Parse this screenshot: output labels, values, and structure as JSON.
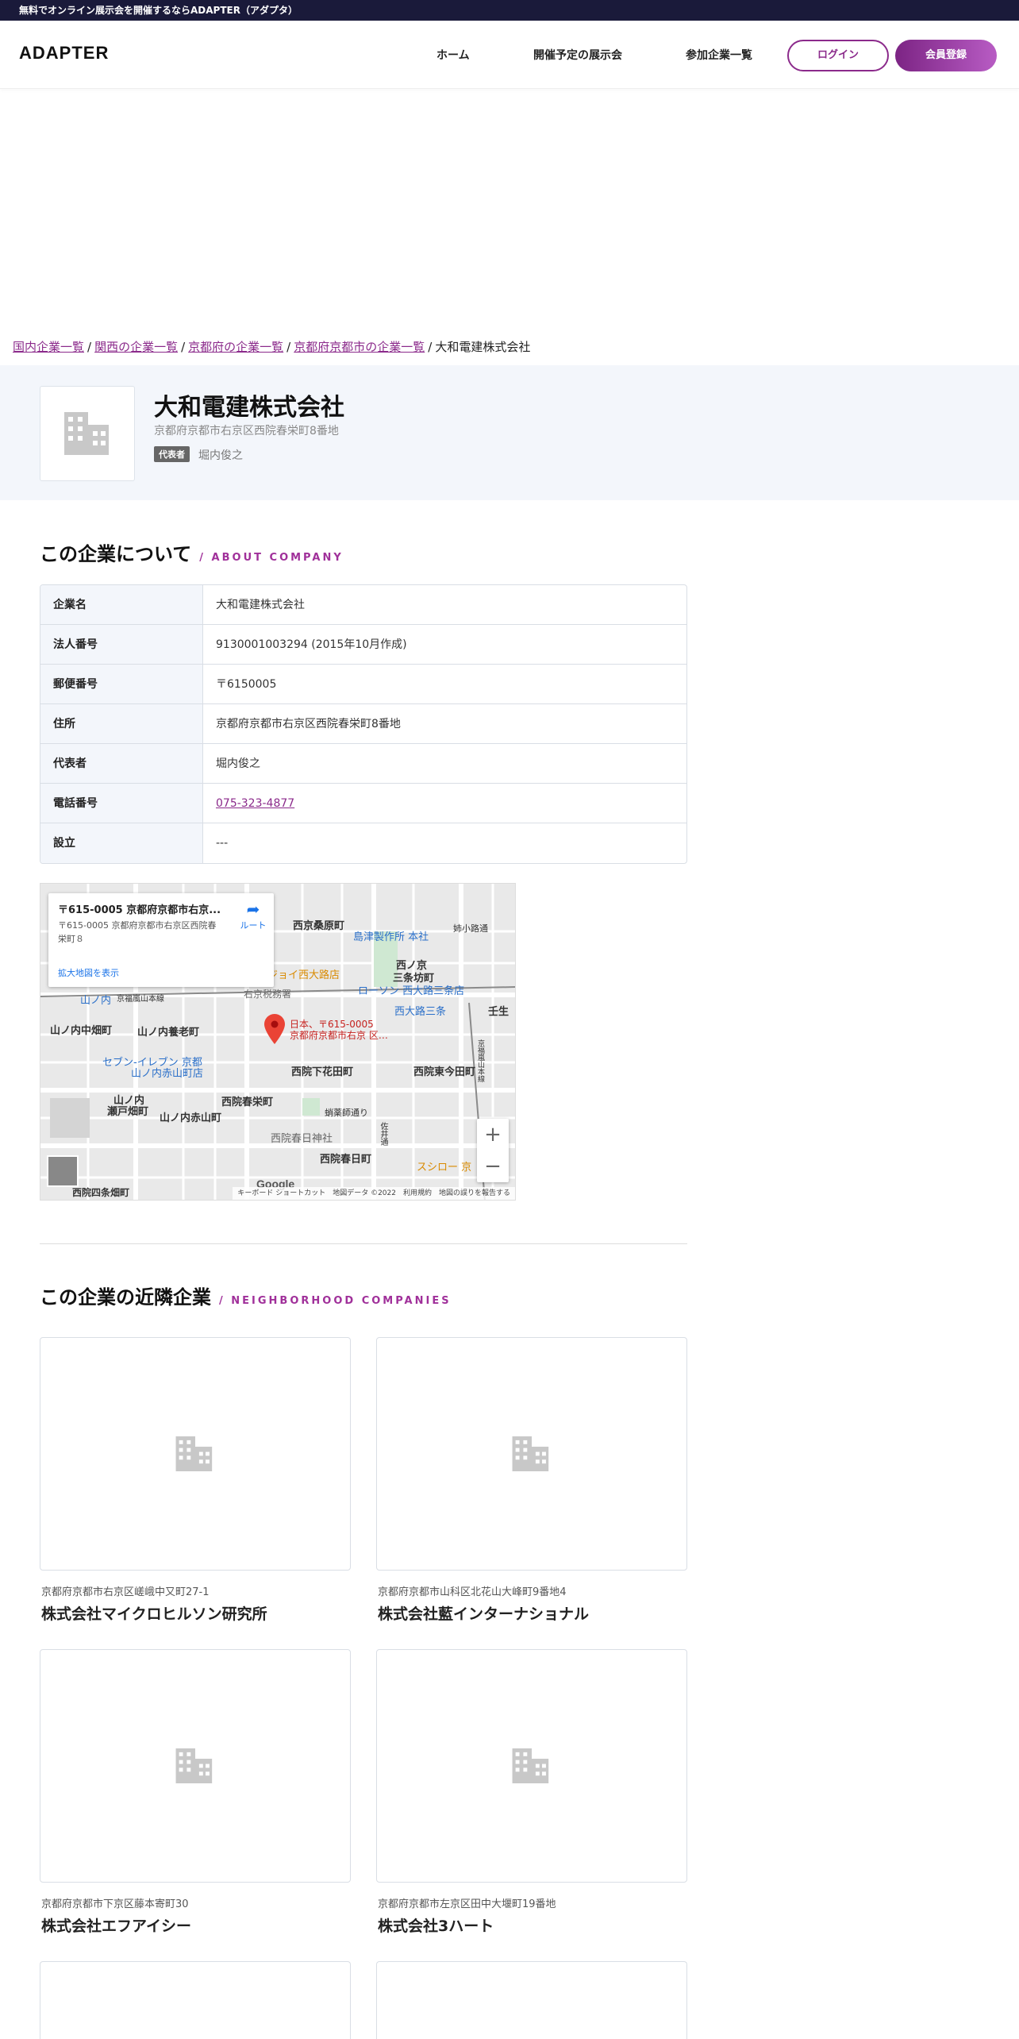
{
  "top_banner": "無料でオンライン展示会を開催するならADAPTER（アダプタ）",
  "header": {
    "logo": "ADAPTER",
    "nav": [
      "ホーム",
      "開催予定の展示会",
      "参加企業一覧"
    ],
    "login": "ログイン",
    "register": "会員登録"
  },
  "breadcrumb": {
    "items": [
      "国内企業一覧",
      "関西の企業一覧",
      "京都府の企業一覧",
      "京都府京都市の企業一覧"
    ],
    "current": "大和電建株式会社",
    "separator": "/"
  },
  "company": {
    "name": "大和電建株式会社",
    "address": "京都府京都市右京区西院春栄町8番地",
    "rep_badge": "代表者",
    "rep_name": "堀内俊之"
  },
  "about": {
    "title": "この企業について",
    "title_en": "/ ABOUT COMPANY",
    "rows": [
      {
        "label": "企業名",
        "value": "大和電建株式会社"
      },
      {
        "label": "法人番号",
        "value": "9130001003294 (2015年10月作成)"
      },
      {
        "label": "郵便番号",
        "value": "〒6150005"
      },
      {
        "label": "住所",
        "value": "京都府京都市右京区西院春栄町8番地"
      },
      {
        "label": "代表者",
        "value": "堀内俊之"
      },
      {
        "label": "電話番号",
        "value": "075-323-4877"
      },
      {
        "label": "設立",
        "value": "---"
      }
    ]
  },
  "map": {
    "card_title": "〒615-0005 京都府京都市右京...",
    "card_addr": "〒615-0005 京都府京都市右京区西院春栄町８",
    "card_link": "拡大地図を表示",
    "route": "ルート",
    "pin_label_1": "日本、〒615-0005",
    "pin_label_2": "京都府京都市右京 区…",
    "labels": {
      "a": "西京桑原町",
      "b": "島津製作所 本社",
      "c": "姉小路通",
      "d": "西ノ京",
      "e": "三条坊町",
      "f": "ジョイ西大路店",
      "g": "右京税務署",
      "h": "ローソン 西大路三条店",
      "i": "西大路三条",
      "j": "壬生",
      "k": "山ノ内",
      "l": "京福嵐山本線",
      "m": "山ノ内中畑町",
      "n": "山ノ内養老町",
      "o": "セブン-イレブン 京都",
      "p": "山ノ内赤山町店",
      "q": "西院下花田町",
      "r": "西院東今田町",
      "s": "山ノ内",
      "t": "瀬戸畑町",
      "u": "山ノ内赤山町",
      "v": "西院春栄町",
      "w": "蛸薬師通り",
      "x": "西院春日神社",
      "y": "西院春日町",
      "z": "スシロー 京",
      "aa": "西院四条畑町",
      "ab": "佐井通",
      "ac": "京福嵐山本線"
    },
    "zoom_in": "+",
    "zoom_out": "−",
    "google": "Google",
    "footer": "キーボード ショートカット　地図データ ©2022　利用規約　地図の誤りを報告する"
  },
  "neighbors": {
    "title": "この企業の近隣企業",
    "title_en": "/ NEIGHBORHOOD COMPANIES",
    "items": [
      {
        "address": "京都府京都市右京区嵯峨中又町27-1",
        "name": "株式会社マイクロヒルソン研究所"
      },
      {
        "address": "京都府京都市山科区北花山大峰町9番地4",
        "name": "株式会社藍インターナショナル"
      },
      {
        "address": "京都府京都市下京区藤本寄町30",
        "name": "株式会社エフアイシー"
      },
      {
        "address": "京都府京都市左京区田中大堰町19番地",
        "name": "株式会社3ハート"
      }
    ]
  },
  "colors": {
    "accent": "#8b2a8b",
    "banner_bg": "#1a1a3a",
    "hero_bg": "#f3f6fb",
    "placeholder_icon": "#c8c8c8"
  },
  "icons": {
    "building": "building-icon",
    "map_pin": "map-pin-icon",
    "route": "route-icon"
  }
}
